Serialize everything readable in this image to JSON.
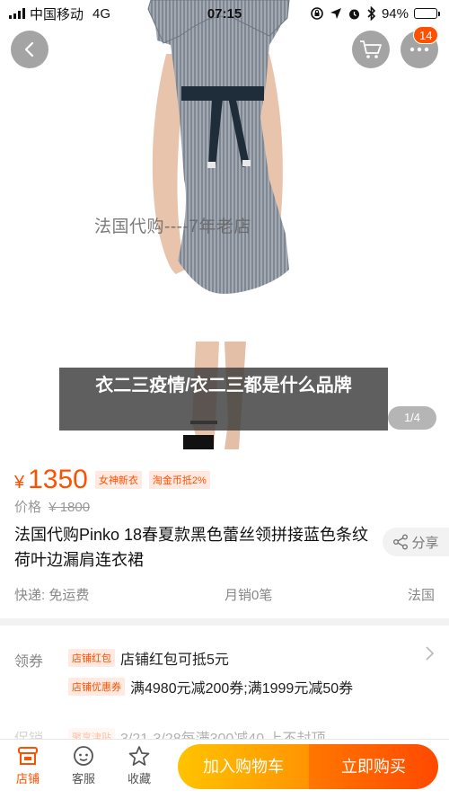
{
  "status_bar": {
    "carrier": "中国移动",
    "network": "4G",
    "time": "07:15",
    "battery": "94%",
    "battery_level": 0.94
  },
  "gallery": {
    "watermark": "法国代购----7年老店",
    "page_indicator": "1/4",
    "cart_badge": "14"
  },
  "overlay_title": "衣二三疫情/衣二三都是什么品牌",
  "price": {
    "currency": "¥",
    "value": "1350",
    "tags": [
      "女神新衣",
      "淘金币抵2%"
    ],
    "original_label": "价格",
    "original_price": "¥ 1800"
  },
  "product": {
    "title": "法国代购Pinko 18春夏款黑色蕾丝领拼接蓝色条纹荷叶边漏肩连衣裙",
    "share_label": "分享",
    "shipping": "快递: 免运费",
    "sales": "月销0笔",
    "origin": "法国"
  },
  "promotions": {
    "coupon_label": "领券",
    "items": [
      {
        "tag": "店铺红包",
        "text": "店铺红包可抵5元"
      },
      {
        "tag": "店铺优惠券",
        "text": "满4980元减200券;满1999元减50券"
      }
    ],
    "promo_label": "促销",
    "promo_tag": "聚享津贴",
    "promo_text": "3/21-3/28每满300减40 上不封顶"
  },
  "bottom_bar": {
    "shop": "店铺",
    "service": "客服",
    "favorite": "收藏",
    "add_to_cart": "加入购物车",
    "buy_now": "立即购买"
  },
  "colors": {
    "accent": "#ff5000",
    "add_cart_gradient": [
      "#ffc300",
      "#ff9402"
    ],
    "buy_gradient": [
      "#ff7700",
      "#ff4900"
    ],
    "dress": "#8d949f",
    "belt": "#1f2d3a"
  }
}
